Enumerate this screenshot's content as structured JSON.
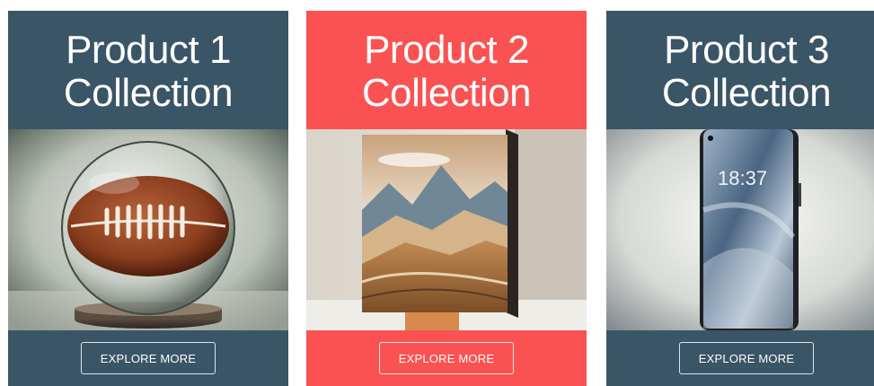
{
  "products": [
    {
      "title_line1": "Product 1",
      "title_line2": "Collection",
      "button_label": "EXPLORE MORE",
      "color": "#3a5566",
      "image": "football-in-glass-sphere"
    },
    {
      "title_line1": "Product 2",
      "title_line2": "Collection",
      "button_label": "EXPLORE MORE",
      "color": "#fa5252",
      "image": "mountain-landscape-canvas"
    },
    {
      "title_line1": "Product 3",
      "title_line2": "Collection",
      "button_label": "EXPLORE MORE",
      "color": "#3a5566",
      "image": "smartphone",
      "screen_time": "18:37"
    }
  ]
}
